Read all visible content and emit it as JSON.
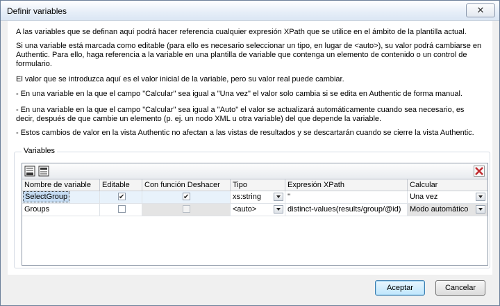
{
  "window": {
    "title": "Definir variables",
    "close_glyph": "✕"
  },
  "intro": [
    "A las variables que se definan aquí podrá hacer referencia cualquier expresión XPath que se utilice en el ámbito de la plantilla actual.",
    "Si una variable está marcada como editable (para ello es necesario seleccionar un tipo, en lugar de <auto>), su valor podrá cambiarse en Authentic. Para ello, haga referencia a la variable en una plantilla de variable que contenga un elemento de contenido o un control de formulario.",
    "El valor que se introduzca aquí es el valor inicial de la variable, pero su valor real puede cambiar.",
    "- En una variable en la que el campo \"Calcular\" sea igual a \"Una vez\" el valor solo cambia si se edita en Authentic de forma manual.",
    "- En una variable en la que el campo \"Calcular\" sea igual a \"Auto\" el valor se actualizará automáticamente cuando sea necesario, es decir, después de que cambie un elemento (p. ej. un nodo XML u otra variable) del que depende la variable.",
    "- Estos cambios de valor en la vista Authentic no afectan a las vistas de resultados y se descartarán cuando se cierre la vista Authentic."
  ],
  "variables_group": {
    "label": "Variables",
    "toolbar": {
      "icons": [
        "append-row-icon",
        "insert-row-icon",
        "delete-row-icon"
      ]
    },
    "columns": [
      "Nombre de variable",
      "Editable",
      "Con función Deshacer",
      "Tipo",
      "Expresión XPath",
      "Calcular"
    ],
    "rows": [
      {
        "name": "SelectGroup",
        "editable": true,
        "undo": true,
        "undo_enabled": true,
        "type": "xs:string",
        "xpath": "''",
        "calc": "Una vez",
        "selected": true
      },
      {
        "name": "Groups",
        "editable": false,
        "undo": false,
        "undo_enabled": false,
        "type": "<auto>",
        "xpath": "distinct-values(results/group/@id)",
        "calc": "Modo automático",
        "selected": false
      }
    ]
  },
  "buttons": {
    "ok": "Aceptar",
    "cancel": "Cancelar"
  },
  "colors": {
    "selected_row": "#e8f2fb",
    "disabled_cell": "#e4e4e4",
    "delete_icon": "#c0282d"
  }
}
